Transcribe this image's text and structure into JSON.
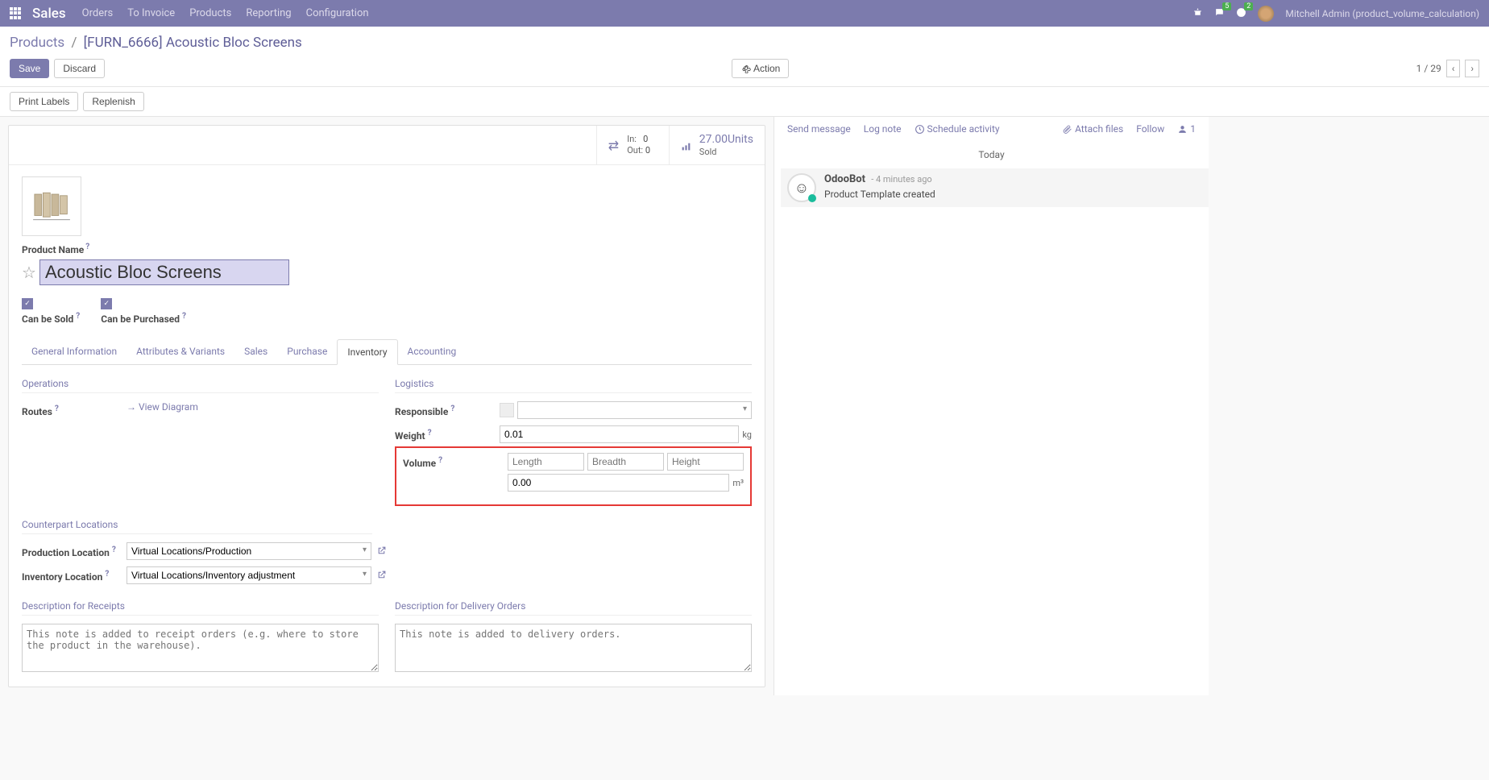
{
  "nav": {
    "brand": "Sales",
    "menu": [
      "Orders",
      "To Invoice",
      "Products",
      "Reporting",
      "Configuration"
    ],
    "chat_badge": "5",
    "activity_badge": "2",
    "user": "Mitchell Admin (product_volume_calculation)"
  },
  "breadcrumb": {
    "root": "Products",
    "current": "[FURN_6666] Acoustic Bloc Screens"
  },
  "buttons": {
    "save": "Save",
    "discard": "Discard",
    "action": "Action",
    "print_labels": "Print Labels",
    "replenish": "Replenish"
  },
  "pager": {
    "text": "1 / 29"
  },
  "stats": {
    "in_label": "In:",
    "in_val": "0",
    "out_label": "Out:",
    "out_val": "0",
    "sold_value": "27.00",
    "sold_units": "Units",
    "sold_label": "Sold"
  },
  "product": {
    "name_label": "Product Name",
    "name": "Acoustic Bloc Screens",
    "can_be_sold": "Can be Sold",
    "can_be_purchased": "Can be Purchased"
  },
  "tabs": [
    "General Information",
    "Attributes & Variants",
    "Sales",
    "Purchase",
    "Inventory",
    "Accounting"
  ],
  "inventory": {
    "operations": "Operations",
    "routes": "Routes",
    "view_diagram": "View Diagram",
    "logistics": "Logistics",
    "responsible": "Responsible",
    "weight": "Weight",
    "weight_val": "0.01",
    "weight_unit": "kg",
    "volume": "Volume",
    "length_ph": "Length",
    "breadth_ph": "Breadth",
    "height_ph": "Height",
    "volume_val": "0.00",
    "volume_unit": "m³",
    "counterpart": "Counterpart Locations",
    "prod_loc": "Production Location",
    "prod_loc_val": "Virtual Locations/Production",
    "inv_loc": "Inventory Location",
    "inv_loc_val": "Virtual Locations/Inventory adjustment",
    "desc_receipts": "Description for Receipts",
    "desc_receipts_ph": "This note is added to receipt orders (e.g. where to store the product in the warehouse).",
    "desc_delivery": "Description for Delivery Orders",
    "desc_delivery_ph": "This note is added to delivery orders."
  },
  "chatter": {
    "send": "Send message",
    "log": "Log note",
    "schedule": "Schedule activity",
    "attach": "Attach files",
    "follow": "Follow",
    "followers": "1",
    "today": "Today",
    "author": "OdooBot",
    "time": "- 4 minutes ago",
    "body": "Product Template created"
  }
}
